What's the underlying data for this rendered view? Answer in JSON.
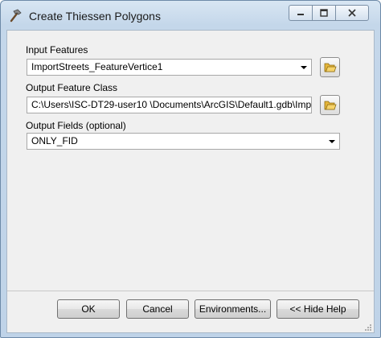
{
  "window": {
    "title": "Create Thiessen Polygons"
  },
  "fields": {
    "input_features": {
      "label": "Input Features",
      "value": "ImportStreets_FeatureVertice1"
    },
    "output_feature_class": {
      "label": "Output Feature Class",
      "value": "C:\\Users\\ISC-DT29-user10 \\Documents\\ArcGIS\\Default1.gdb\\Imp"
    },
    "output_fields": {
      "label": "Output Fields (optional)",
      "value": "ONLY_FID"
    }
  },
  "buttons": {
    "ok": "OK",
    "cancel": "Cancel",
    "environments": "Environments...",
    "hide_help": "<< Hide Help"
  }
}
